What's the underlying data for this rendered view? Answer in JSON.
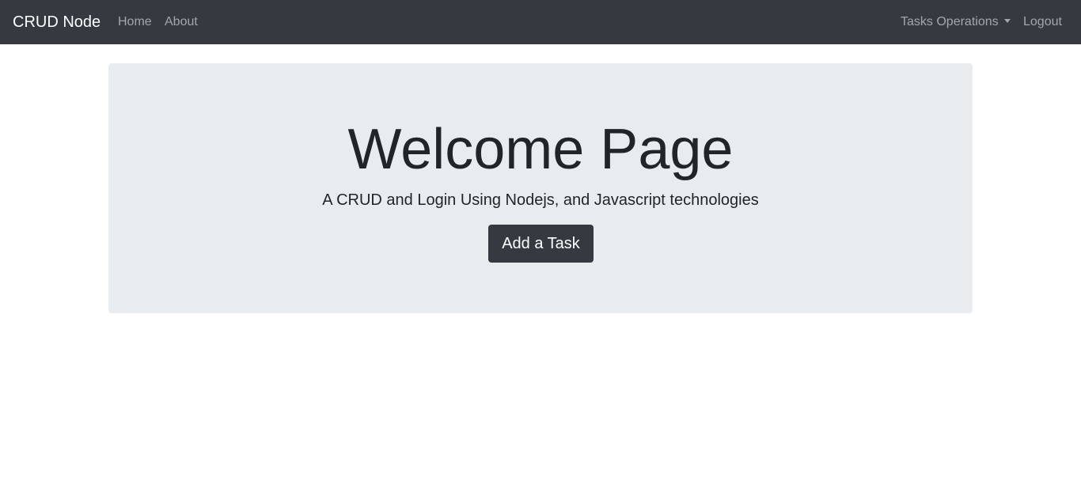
{
  "navbar": {
    "brand": "CRUD Node",
    "left_links": [
      "Home",
      "About"
    ],
    "dropdown_label": "Tasks Operations",
    "logout_label": "Logout"
  },
  "hero": {
    "title": "Welcome Page",
    "lead": "A CRUD and Login Using Nodejs, and Javascript technologies",
    "button_label": "Add a Task"
  },
  "colors": {
    "navbar_bg": "#343a40",
    "jumbotron_bg": "#e9ecef",
    "button_bg": "#343a40",
    "text": "#212529"
  },
  "icons": {
    "dropdown": "caret-down-icon"
  }
}
